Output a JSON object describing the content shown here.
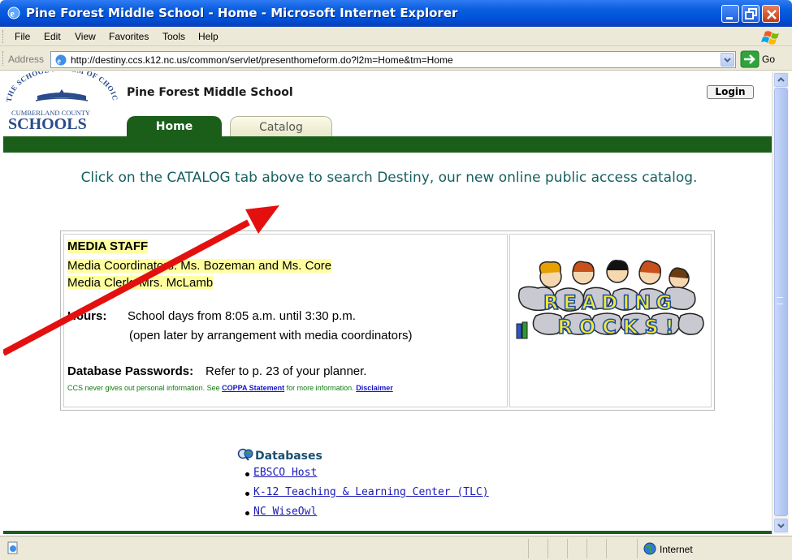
{
  "window": {
    "title": "Pine Forest Middle School - Home - Microsoft Internet Explorer"
  },
  "menu": {
    "file": "File",
    "edit": "Edit",
    "view": "View",
    "favorites": "Favorites",
    "tools": "Tools",
    "help": "Help"
  },
  "address": {
    "label": "Address",
    "url": "http://destiny.ccs.k12.nc.us/common/servlet/presenthomeform.do?l2m=Home&tm=Home",
    "go_label": "Go"
  },
  "logo": {
    "arc_text": "THE SCHOOL SYSTEM OF CHOICE",
    "county": "CUMBERLAND COUNTY",
    "schools": "SCHOOLS"
  },
  "header": {
    "school_name": "Pine Forest Middle School",
    "login_label": "Login"
  },
  "tabs": {
    "home": "Home",
    "catalog": "Catalog"
  },
  "intro": {
    "text": "Click on the CATALOG tab above to search Destiny, our new online public access catalog."
  },
  "media": {
    "heading": "MEDIA STAFF",
    "coordinators": "Media Coordinators: Ms. Bozeman and Ms. Core",
    "clerk": "Media Clerk: Mrs. McLamb",
    "hours_label": "Hours:",
    "hours_text": "School days from 8:05 a.m. until 3:30 p.m.",
    "hours_note": "(open later by arrangement with media coordinators)",
    "db_passwords_label": "Database Passwords:",
    "db_passwords_text": "Refer to p. 23 of your planner.",
    "privacy_text": "CCS never gives out personal information. See",
    "coppa_link": "COPPA Statement",
    "privacy_text_2": "for more information.",
    "disclaimer_link": "Disclaimer"
  },
  "reading_rocks": {
    "line1": "READING",
    "line2": "ROCKS!"
  },
  "databases": {
    "title": "Databases",
    "items": [
      {
        "label": "EBSCO Host"
      },
      {
        "label": "K-12 Teaching & Learning Center (TLC)"
      },
      {
        "label": "NC WiseOwl"
      }
    ]
  },
  "status": {
    "zone": "Internet"
  },
  "colors": {
    "accent_green": "#1a5e1a",
    "intro_teal": "#166060",
    "highlight": "#ffff9f",
    "arrow_red": "#e41010"
  }
}
